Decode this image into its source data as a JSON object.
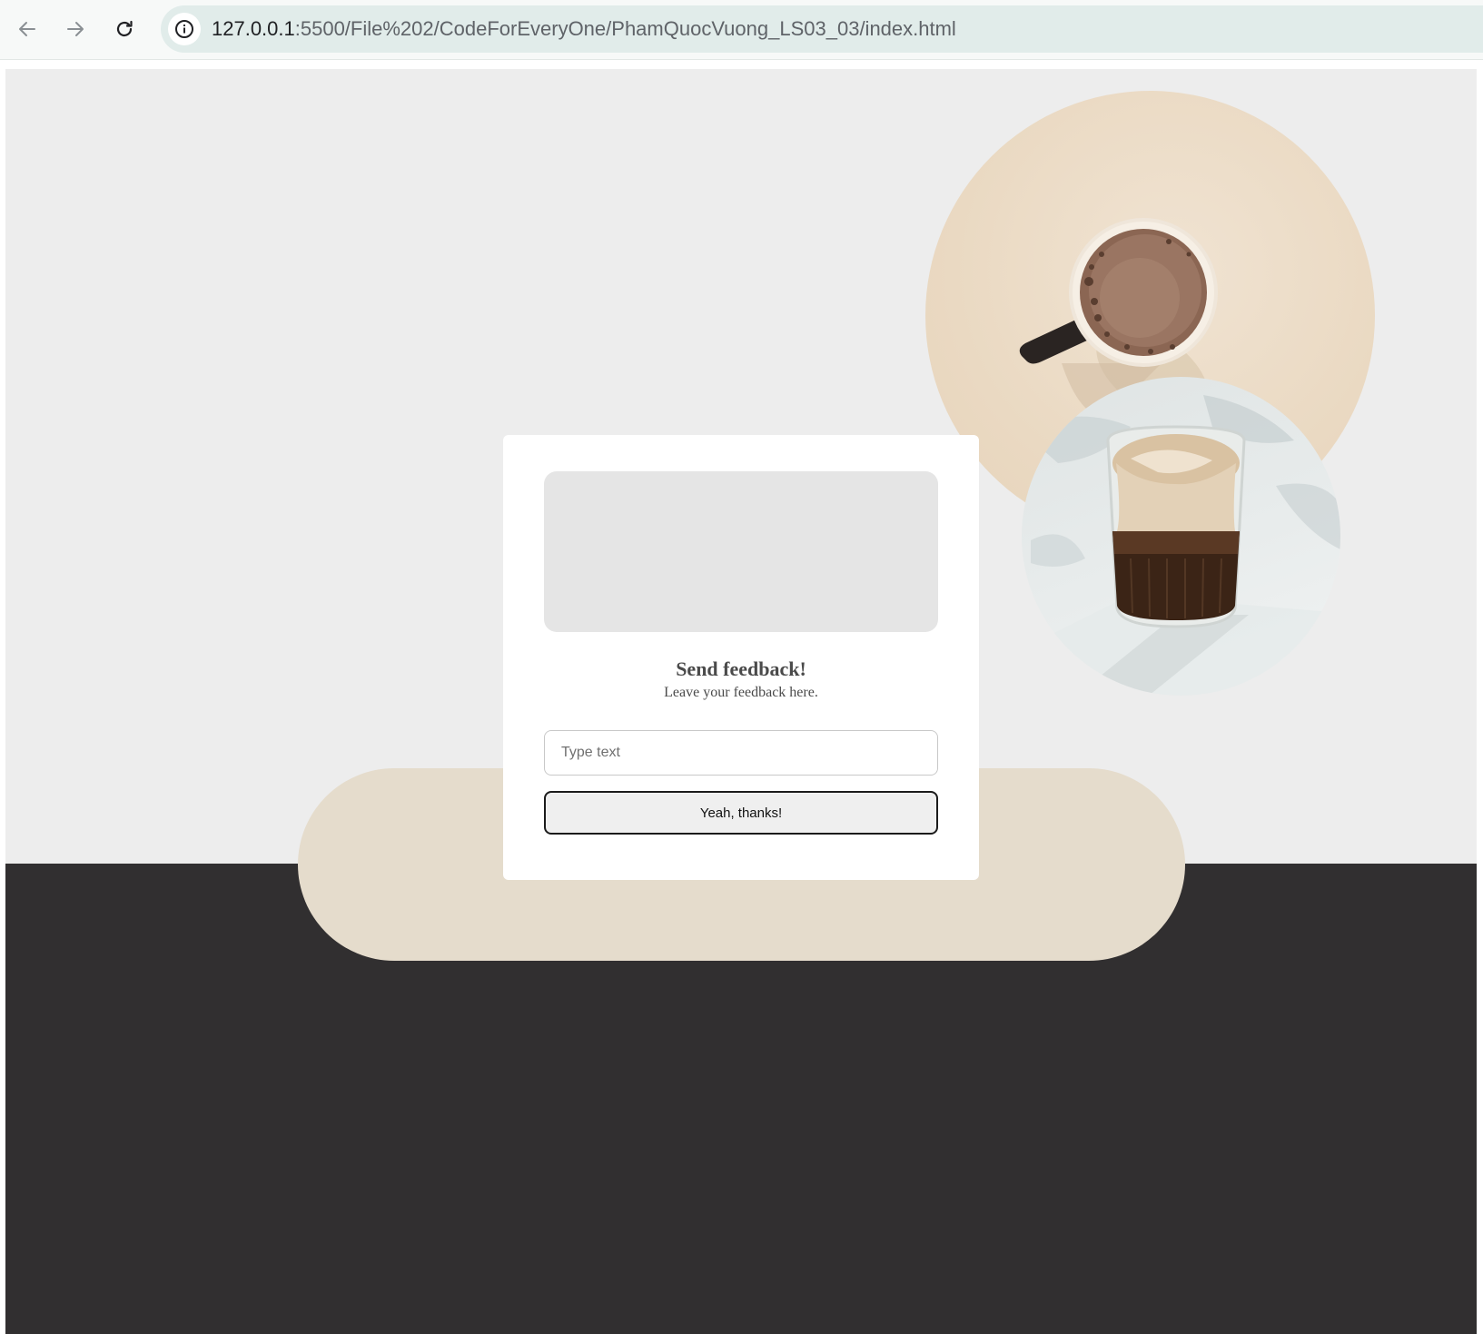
{
  "browser": {
    "url_host": "127.0.0.1",
    "url_path": ":5500/File%202/CodeForEveryOne/PhamQuocVuong_LS03_03/index.html",
    "icons": {
      "back": "arrow-left-icon",
      "forward": "arrow-right-icon",
      "reload": "reload-icon",
      "site_info": "info-icon"
    }
  },
  "page": {
    "colors": {
      "background": "#ededed",
      "dark_band": "#312f30",
      "beige_pill": "#e5dccc",
      "card": "#ffffff"
    },
    "images": {
      "mug": "coffee-mug-top-view",
      "glass": "iced-coffee-glass"
    }
  },
  "feedback": {
    "title": "Send feedback!",
    "subtitle": "Leave your feedback here.",
    "input_placeholder": "Type text",
    "submit_label": "Yeah, thanks!"
  }
}
